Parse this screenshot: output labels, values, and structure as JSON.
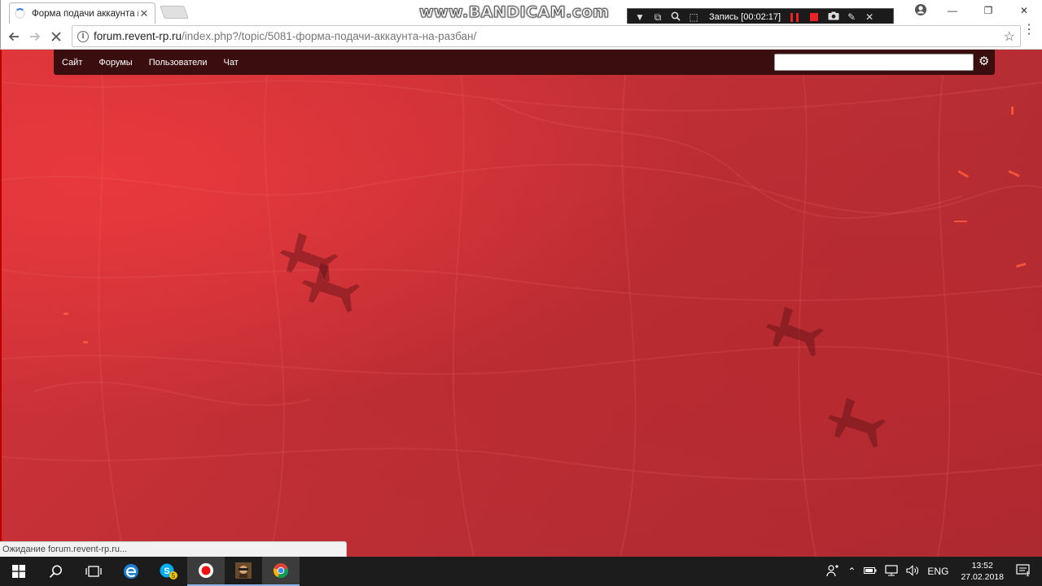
{
  "browser": {
    "tab_title": "Форма подачи аккаунта на разбан",
    "url_host": "forum.revent-rp.ru",
    "url_path": "/index.php?/topic/5081-форма-подачи-аккаунта-на-разбан/",
    "status_text": "Ожидание forum.revent-rp.ru..."
  },
  "recorder": {
    "watermark": "www.BANDICAM.com",
    "record_label": "Запись [00:02:17]"
  },
  "forum_nav": {
    "items": [
      "Сайт",
      "Форумы",
      "Пользователи",
      "Чат"
    ],
    "search_placeholder": ""
  },
  "taskbar": {
    "language": "ENG",
    "time": "13:52",
    "date": "27.02.2018",
    "skype_badge": "5",
    "notification_count": "1"
  },
  "colors": {
    "page_background": "#c03035",
    "forum_nav_bar": "#3a0d0f",
    "record_red": "#e22222"
  }
}
